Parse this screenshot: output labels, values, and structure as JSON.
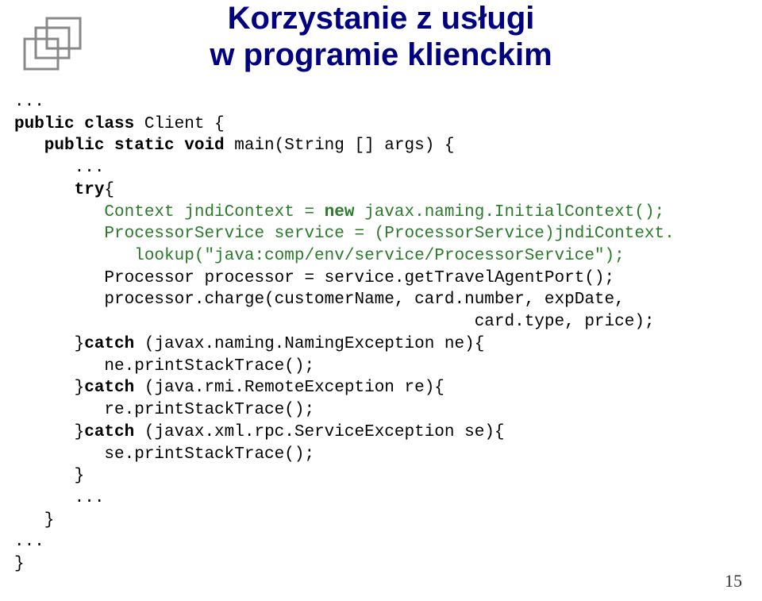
{
  "title_line1": "Korzystanie z usługi",
  "title_line2": "w programie klienckim",
  "code": {
    "l1": "...",
    "l2a": "public class ",
    "l2b": "Client {",
    "l3a": "   public static void ",
    "l3b": "main(String [] args) {",
    "l4": "      ...",
    "l5a": "      try",
    "l5b": "{",
    "l6a": "         Context jndiContext = ",
    "l6b": "new ",
    "l6c": "javax.naming.InitialContext();",
    "l7": "         ProcessorService service = (ProcessorService)jndiContext.",
    "l8": "            lookup(\"java:comp/env/service/ProcessorService\");",
    "l9": "         Processor processor = service.getTravelAgentPort();",
    "l10": "         processor.charge(customerName, card.number, expDate,",
    "l11": "                                              card.type, price);",
    "l12a": "      }",
    "l12b": "catch ",
    "l12c": "(javax.naming.NamingException ne){",
    "l13": "         ne.printStackTrace();",
    "l14a": "      }",
    "l14b": "catch ",
    "l14c": "(java.rmi.RemoteException re){",
    "l15": "         re.printStackTrace();",
    "l16a": "      }",
    "l16b": "catch ",
    "l16c": "(javax.xml.rpc.ServiceException se){",
    "l17": "         se.printStackTrace();",
    "l18": "      }",
    "l19": "      ...",
    "l20": "   }",
    "l21": "...",
    "l22": "}"
  },
  "page_number": "15"
}
